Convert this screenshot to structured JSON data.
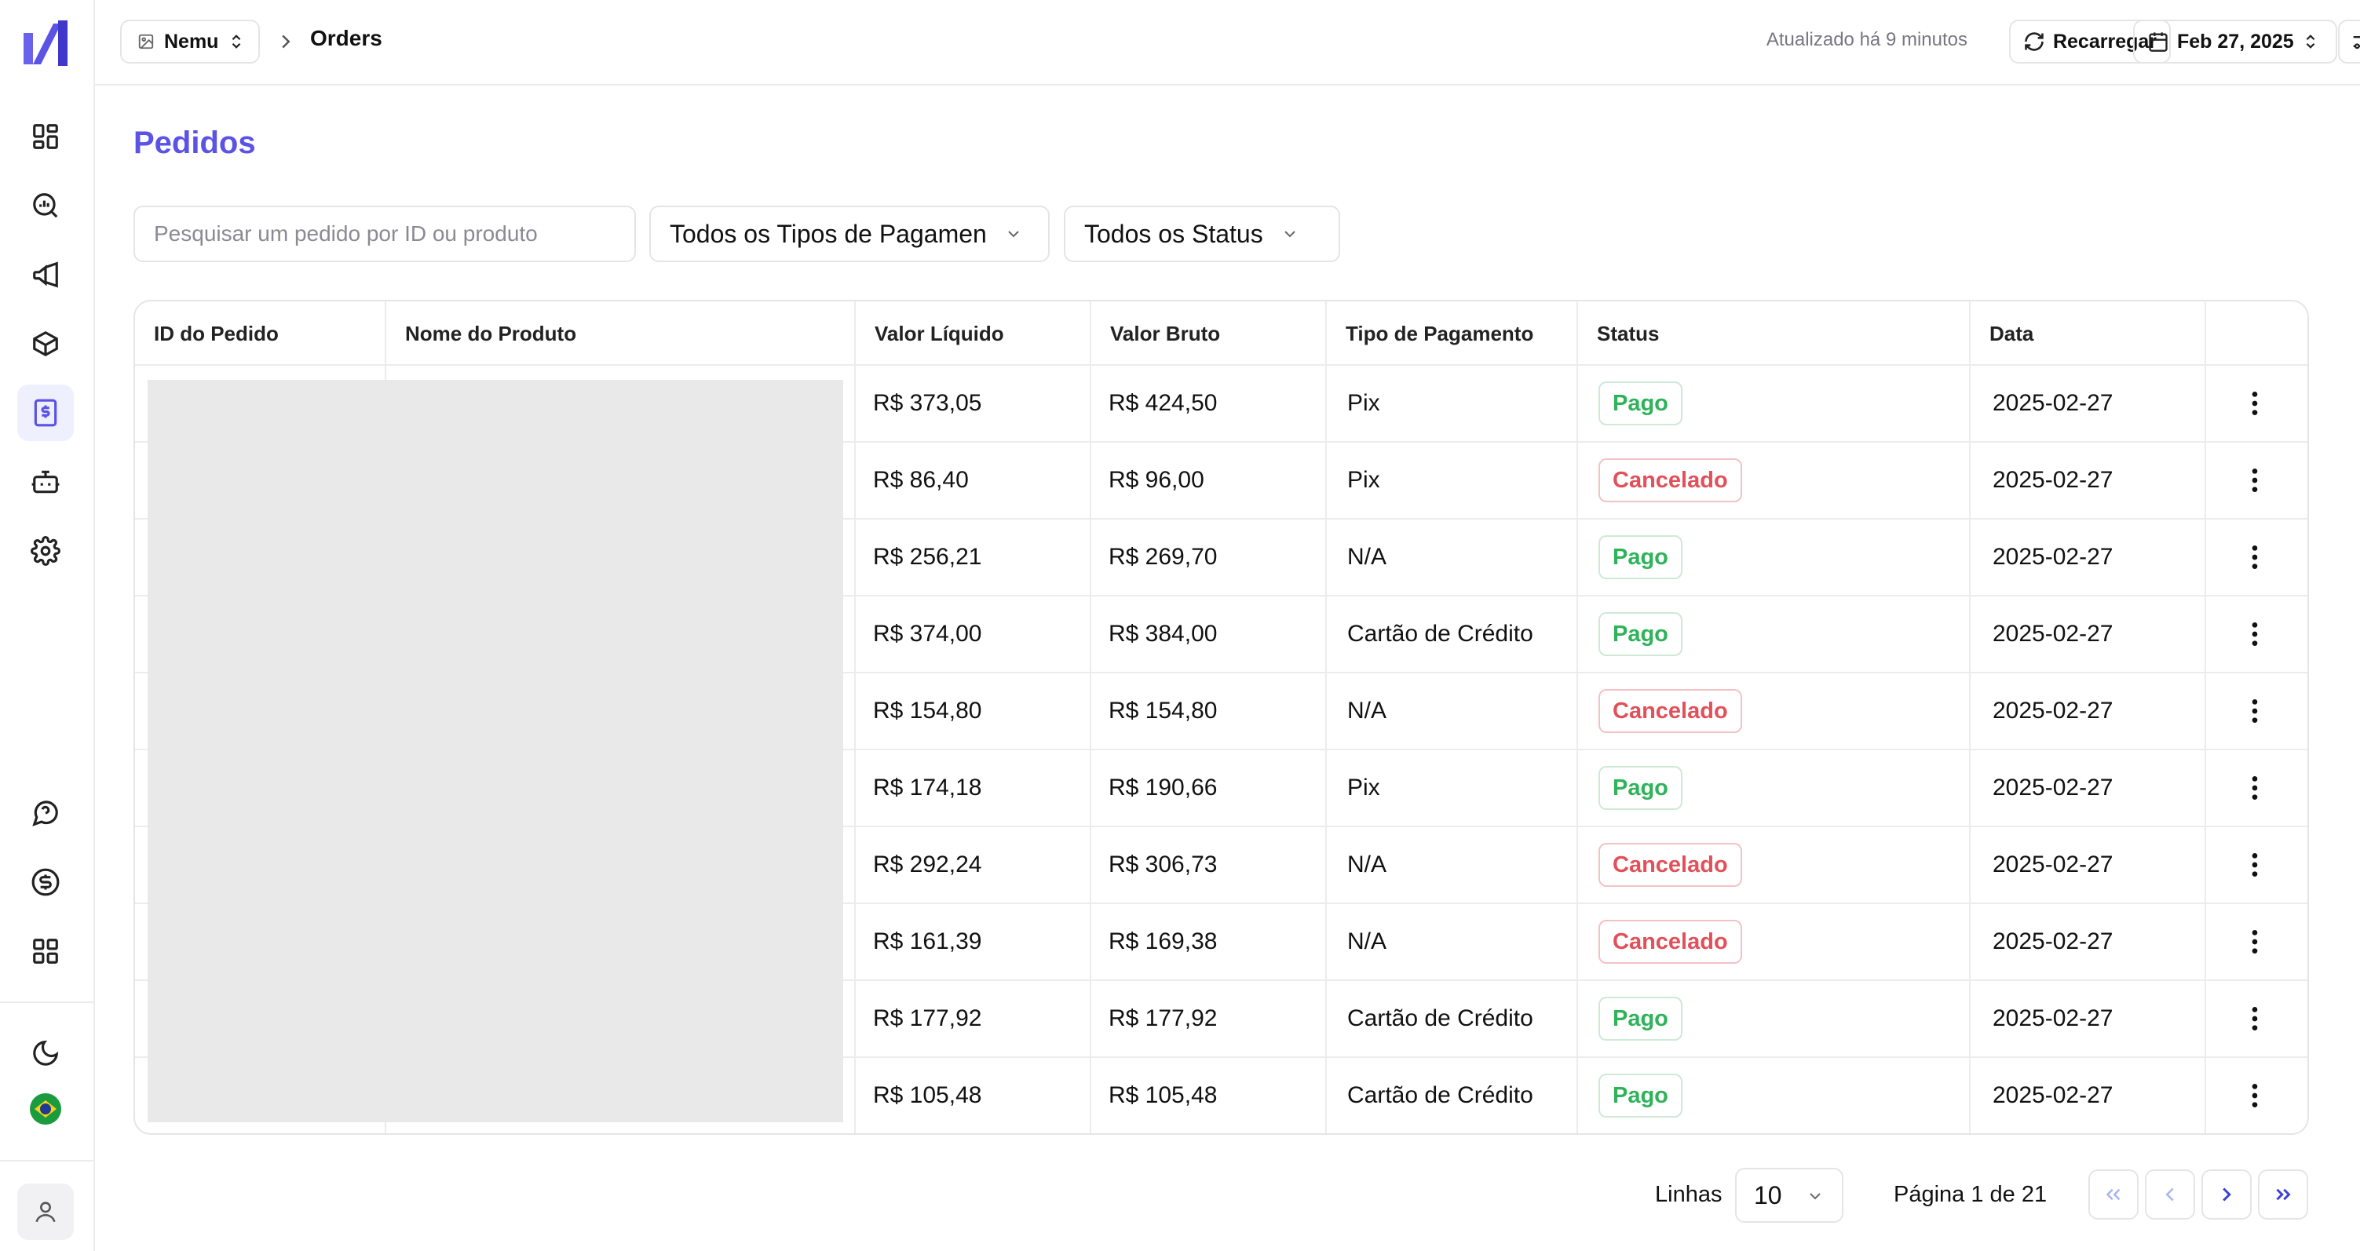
{
  "header": {
    "workspace": "Nemu",
    "breadcrumb": "Orders",
    "updated_text": "Atualizado há 9 minutos",
    "reload_label": "Recarregar",
    "date_label": "Feb 27, 2025"
  },
  "sidebar": {
    "items": [
      {
        "icon": "dashboard-icon",
        "active": false
      },
      {
        "icon": "analytics-search-icon",
        "active": false
      },
      {
        "icon": "megaphone-icon",
        "active": false
      },
      {
        "icon": "package-icon",
        "active": false
      },
      {
        "icon": "dollar-receipt-icon",
        "active": true
      },
      {
        "icon": "bot-icon",
        "active": false
      },
      {
        "icon": "gear-icon",
        "active": false
      }
    ],
    "bottom_items": [
      {
        "icon": "help-icon"
      },
      {
        "icon": "dollar-circle-icon"
      },
      {
        "icon": "apps-grid-icon"
      }
    ]
  },
  "page": {
    "title": "Pedidos",
    "search_placeholder": "Pesquisar um pedido por ID ou produto",
    "payment_filter": "Todos os Tipos de Pagamen",
    "status_filter": "Todos os Status"
  },
  "table": {
    "columns": [
      "ID do Pedido",
      "Nome do Produto",
      "Valor Líquido",
      "Valor Bruto",
      "Tipo de Pagamento",
      "Status",
      "Data"
    ],
    "rows": [
      {
        "net": "R$ 373,05",
        "gross": "R$ 424,50",
        "payment": "Pix",
        "status": "Pago",
        "date": "2025-02-27"
      },
      {
        "net": "R$ 86,40",
        "gross": "R$ 96,00",
        "payment": "Pix",
        "status": "Cancelado",
        "date": "2025-02-27"
      },
      {
        "net": "R$ 256,21",
        "gross": "R$ 269,70",
        "payment": "N/A",
        "status": "Pago",
        "date": "2025-02-27"
      },
      {
        "net": "R$ 374,00",
        "gross": "R$ 384,00",
        "payment": "Cartão de Crédito",
        "status": "Pago",
        "date": "2025-02-27"
      },
      {
        "net": "R$ 154,80",
        "gross": "R$ 154,80",
        "payment": "N/A",
        "status": "Cancelado",
        "date": "2025-02-27"
      },
      {
        "net": "R$ 174,18",
        "gross": "R$ 190,66",
        "payment": "Pix",
        "status": "Pago",
        "date": "2025-02-27"
      },
      {
        "net": "R$ 292,24",
        "gross": "R$ 306,73",
        "payment": "N/A",
        "status": "Cancelado",
        "date": "2025-02-27"
      },
      {
        "net": "R$ 161,39",
        "gross": "R$ 169,38",
        "payment": "N/A",
        "status": "Cancelado",
        "date": "2025-02-27"
      },
      {
        "net": "R$ 177,92",
        "gross": "R$ 177,92",
        "payment": "Cartão de Crédito",
        "status": "Pago",
        "date": "2025-02-27"
      },
      {
        "net": "R$ 105,48",
        "gross": "R$ 105,48",
        "payment": "Cartão de Crédito",
        "status": "Pago",
        "date": "2025-02-27"
      }
    ]
  },
  "pagination": {
    "rows_label": "Linhas",
    "rows_value": "10",
    "page_text": "Página 1 de 21"
  },
  "colors": {
    "accent": "#5b52e6",
    "paid": "#2fb35a",
    "cancelled": "#e2505a"
  }
}
